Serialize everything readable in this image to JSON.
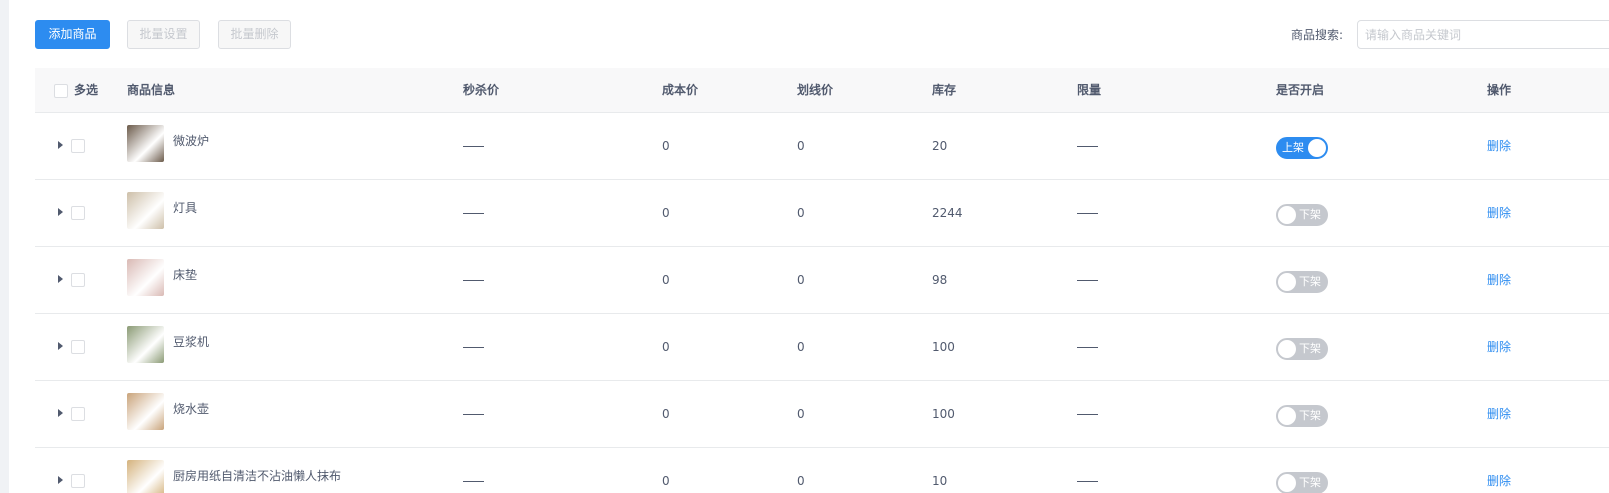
{
  "toolbar": {
    "add_label": "添加商品",
    "batch_set_label": "批量设置",
    "batch_delete_label": "批量删除",
    "search_label": "商品搜索:",
    "search_placeholder": "请输入商品关键词",
    "search_value": ""
  },
  "table": {
    "headers": {
      "select": "多选",
      "info": "商品信息",
      "flash_price": "秒杀价",
      "cost_price": "成本价",
      "strike_price": "划线价",
      "stock": "库存",
      "limit": "限量",
      "enabled": "是否开启",
      "action": "操作"
    },
    "rows": [
      {
        "name": "微波炉",
        "flash_price": "——",
        "cost_price": "0",
        "strike_price": "0",
        "stock": "20",
        "limit": "——",
        "enabled": true,
        "switch_label": "上架",
        "action": "删除",
        "thumb_color": "#6b5a4a"
      },
      {
        "name": "灯具",
        "flash_price": "——",
        "cost_price": "0",
        "strike_price": "0",
        "stock": "2244",
        "limit": "——",
        "enabled": false,
        "switch_label": "下架",
        "action": "删除",
        "thumb_color": "#cdbfa8"
      },
      {
        "name": "床垫",
        "flash_price": "——",
        "cost_price": "0",
        "strike_price": "0",
        "stock": "98",
        "limit": "——",
        "enabled": false,
        "switch_label": "下架",
        "action": "删除",
        "thumb_color": "#d9b9b4"
      },
      {
        "name": "豆浆机",
        "flash_price": "——",
        "cost_price": "0",
        "strike_price": "0",
        "stock": "100",
        "limit": "——",
        "enabled": false,
        "switch_label": "下架",
        "action": "删除",
        "thumb_color": "#8a9a74"
      },
      {
        "name": "烧水壶",
        "flash_price": "——",
        "cost_price": "0",
        "strike_price": "0",
        "stock": "100",
        "limit": "——",
        "enabled": false,
        "switch_label": "下架",
        "action": "删除",
        "thumb_color": "#c9a37a"
      },
      {
        "name": "厨房用纸自清洁不沾油懒人抹布",
        "flash_price": "——",
        "cost_price": "0",
        "strike_price": "0",
        "stock": "10",
        "limit": "——",
        "enabled": false,
        "switch_label": "下架",
        "action": "删除",
        "thumb_color": "#d4b27c"
      }
    ]
  },
  "colors": {
    "primary": "#2d8cf0",
    "switch_off": "#c5c8ce",
    "header_bg": "#f8f8f9"
  }
}
